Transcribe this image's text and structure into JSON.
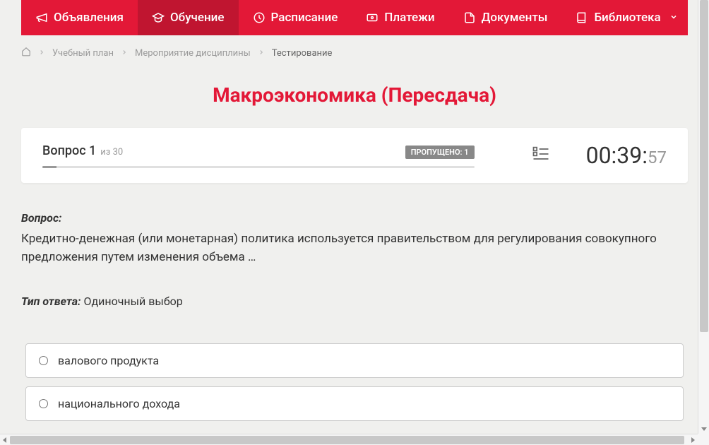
{
  "nav": {
    "items": [
      {
        "label": "Объявления"
      },
      {
        "label": "Обучение"
      },
      {
        "label": "Расписание"
      },
      {
        "label": "Платежи"
      },
      {
        "label": "Документы"
      },
      {
        "label": "Библиотека"
      }
    ]
  },
  "breadcrumb": {
    "items": [
      {
        "label": "Учебный план"
      },
      {
        "label": "Мероприятие дисциплины"
      },
      {
        "label": "Тестирование"
      }
    ]
  },
  "page_title": "Макроэкономика (Пересдача)",
  "status": {
    "question_label": "Вопрос 1",
    "total_label": "из 30",
    "skipped_label": "ПРОПУЩЕНО: 1",
    "timer_main": "00:39:",
    "timer_seconds": "57"
  },
  "question": {
    "heading": "Вопрос:",
    "text": "Кредитно-денежная (или монетарная) политика используется правительством для регулирования совокупного предложения путем изменения объема …",
    "answer_type_label": "Тип ответа:",
    "answer_type_value": " Одиночный выбор"
  },
  "answers": [
    {
      "text": "валового продукта"
    },
    {
      "text": "национального дохода"
    }
  ]
}
